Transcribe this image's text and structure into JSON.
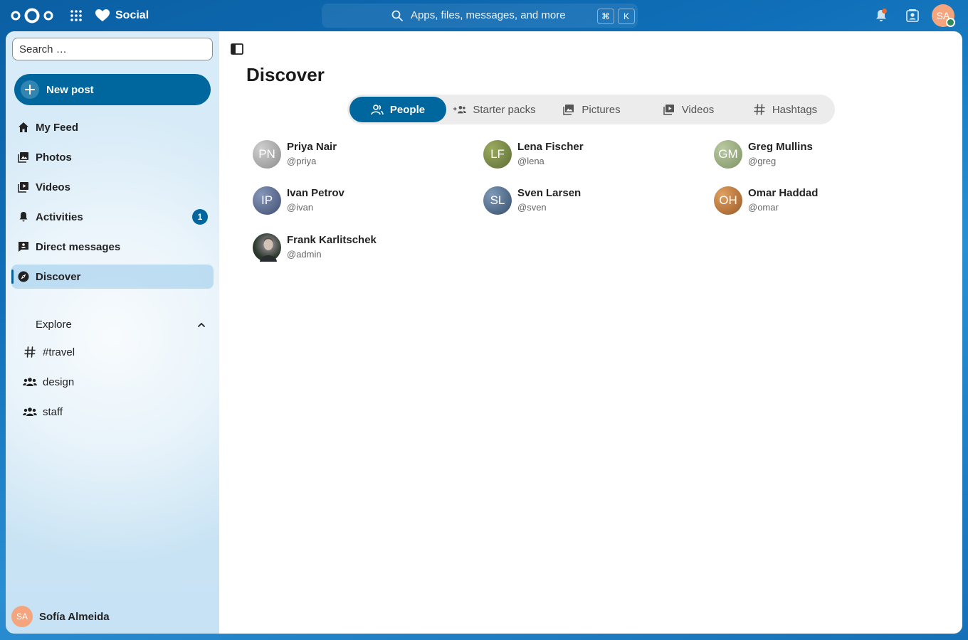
{
  "header": {
    "app_name": "Social",
    "search_placeholder": "Apps, files, messages, and more",
    "shortcut_cmd": "⌘",
    "shortcut_key": "K",
    "user_initials": "SA"
  },
  "sidebar": {
    "search_placeholder": "Search …",
    "new_post_label": "New post",
    "nav": [
      {
        "label": "My Feed",
        "icon": "home-icon"
      },
      {
        "label": "Photos",
        "icon": "image-icon"
      },
      {
        "label": "Videos",
        "icon": "video-icon"
      },
      {
        "label": "Activities",
        "icon": "bell-icon",
        "badge": "1"
      },
      {
        "label": "Direct messages",
        "icon": "message-icon"
      },
      {
        "label": "Discover",
        "icon": "compass-icon",
        "active": true
      }
    ],
    "explore_title": "Explore",
    "explore": [
      {
        "label": "#travel",
        "icon": "hashtag-icon"
      },
      {
        "label": "design",
        "icon": "group-icon"
      },
      {
        "label": "staff",
        "icon": "group-icon"
      }
    ],
    "user": {
      "initials": "SA",
      "name": "Sofía Almeida"
    }
  },
  "main": {
    "title": "Discover",
    "tabs": [
      {
        "label": "People",
        "active": true
      },
      {
        "label": "Starter packs"
      },
      {
        "label": "Pictures"
      },
      {
        "label": "Videos"
      },
      {
        "label": "Hashtags"
      }
    ],
    "people": [
      {
        "initials": "PN",
        "name": "Priya Nair",
        "handle": "@priya"
      },
      {
        "initials": "LF",
        "name": "Lena Fischer",
        "handle": "@lena"
      },
      {
        "initials": "GM",
        "name": "Greg Mullins",
        "handle": "@greg"
      },
      {
        "initials": "IP",
        "name": "Ivan Petrov",
        "handle": "@ivan"
      },
      {
        "initials": "SL",
        "name": "Sven Larsen",
        "handle": "@sven"
      },
      {
        "initials": "OH",
        "name": "Omar Haddad",
        "handle": "@omar"
      },
      {
        "initials": "",
        "name": "Frank Karlitschek",
        "handle": "@admin"
      }
    ]
  },
  "colors": {
    "primary": "#00679e",
    "header_bg": "#0b5fa3",
    "avatar_sa": "#f4a57e",
    "notification_dot": "#e9692c",
    "online_status": "#2e8b57"
  }
}
